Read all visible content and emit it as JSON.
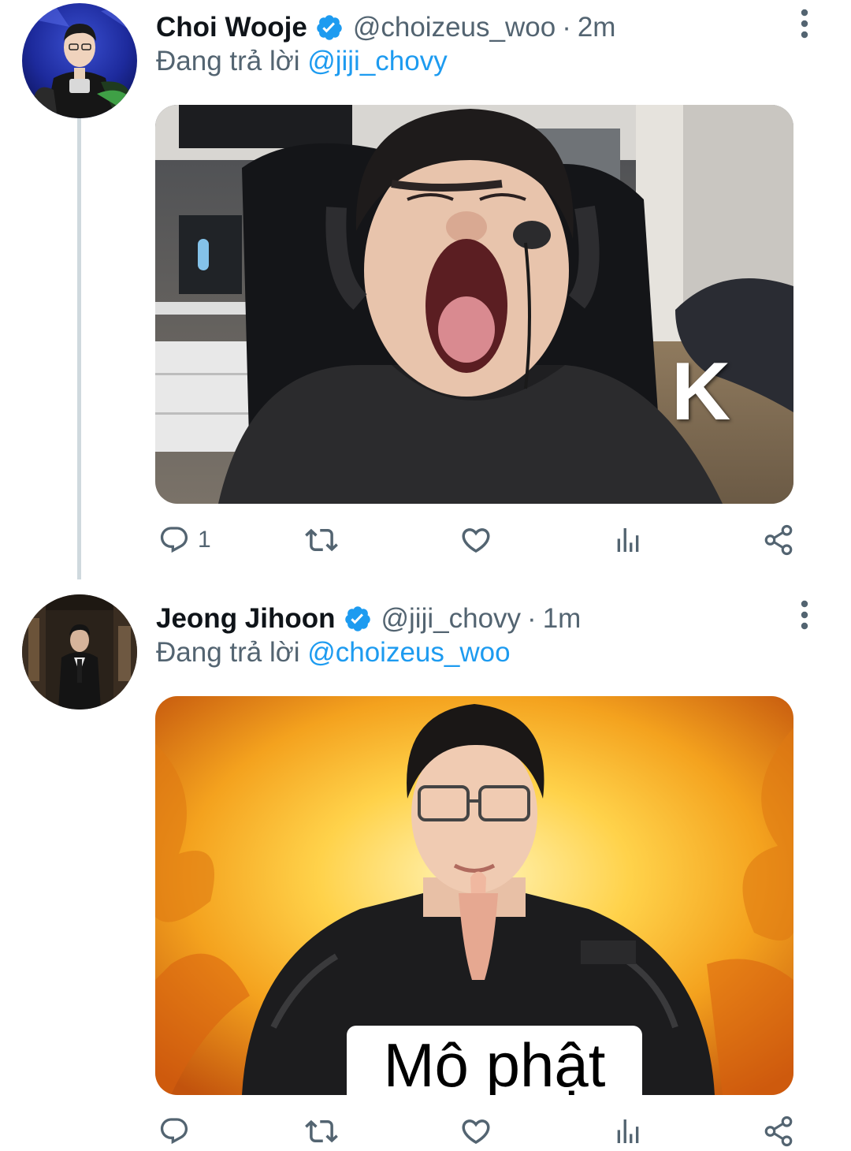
{
  "colors": {
    "link": "#1d9bf0",
    "text_secondary": "#536471",
    "verified": "#1d9bf0",
    "thread_line": "#cfd9de"
  },
  "tweets": [
    {
      "display_name": "Choi Wooje",
      "handle": "@choizeus_woo",
      "separator": "·",
      "time": "2m",
      "replying_prefix": "Đang trả lời",
      "replying_to": "@jiji_chovy",
      "verified_icon": "verified-badge-icon",
      "avatar_icon": "user-avatar-photo",
      "media_caption": "K",
      "reply_count": "1",
      "retweet_count": "",
      "like_count": ""
    },
    {
      "display_name": "Jeong Jihoon",
      "handle": "@jiji_chovy",
      "separator": "·",
      "time": "1m",
      "replying_prefix": "Đang trả lời",
      "replying_to": "@choizeus_woo",
      "verified_icon": "verified-badge-icon",
      "avatar_icon": "user-avatar-photo",
      "media_caption": "Mô phật",
      "reply_count": "",
      "retweet_count": "",
      "like_count": ""
    }
  ]
}
